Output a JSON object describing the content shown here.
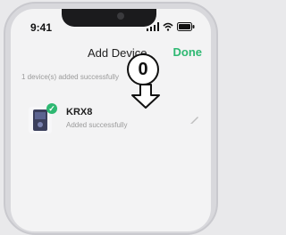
{
  "status_bar": {
    "time": "9:41"
  },
  "nav": {
    "title": "Add Device",
    "done_label": "Done"
  },
  "summary": {
    "count_text": "1 device(s) added successfully"
  },
  "device": {
    "name": "KRX8",
    "status": "Added successfully"
  },
  "annotation": {
    "step_number": "0"
  },
  "colors": {
    "accent": "#2eb872"
  }
}
